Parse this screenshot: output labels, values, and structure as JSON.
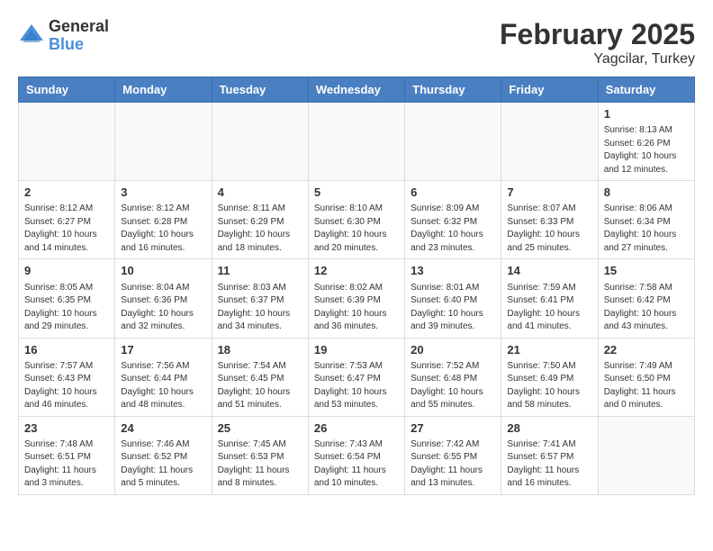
{
  "logo": {
    "general": "General",
    "blue": "Blue"
  },
  "title": {
    "month_year": "February 2025",
    "location": "Yagcilar, Turkey"
  },
  "weekdays": [
    "Sunday",
    "Monday",
    "Tuesday",
    "Wednesday",
    "Thursday",
    "Friday",
    "Saturday"
  ],
  "weeks": [
    [
      {
        "day": "",
        "info": ""
      },
      {
        "day": "",
        "info": ""
      },
      {
        "day": "",
        "info": ""
      },
      {
        "day": "",
        "info": ""
      },
      {
        "day": "",
        "info": ""
      },
      {
        "day": "",
        "info": ""
      },
      {
        "day": "1",
        "info": "Sunrise: 8:13 AM\nSunset: 6:26 PM\nDaylight: 10 hours\nand 12 minutes."
      }
    ],
    [
      {
        "day": "2",
        "info": "Sunrise: 8:12 AM\nSunset: 6:27 PM\nDaylight: 10 hours\nand 14 minutes."
      },
      {
        "day": "3",
        "info": "Sunrise: 8:12 AM\nSunset: 6:28 PM\nDaylight: 10 hours\nand 16 minutes."
      },
      {
        "day": "4",
        "info": "Sunrise: 8:11 AM\nSunset: 6:29 PM\nDaylight: 10 hours\nand 18 minutes."
      },
      {
        "day": "5",
        "info": "Sunrise: 8:10 AM\nSunset: 6:30 PM\nDaylight: 10 hours\nand 20 minutes."
      },
      {
        "day": "6",
        "info": "Sunrise: 8:09 AM\nSunset: 6:32 PM\nDaylight: 10 hours\nand 23 minutes."
      },
      {
        "day": "7",
        "info": "Sunrise: 8:07 AM\nSunset: 6:33 PM\nDaylight: 10 hours\nand 25 minutes."
      },
      {
        "day": "8",
        "info": "Sunrise: 8:06 AM\nSunset: 6:34 PM\nDaylight: 10 hours\nand 27 minutes."
      }
    ],
    [
      {
        "day": "9",
        "info": "Sunrise: 8:05 AM\nSunset: 6:35 PM\nDaylight: 10 hours\nand 29 minutes."
      },
      {
        "day": "10",
        "info": "Sunrise: 8:04 AM\nSunset: 6:36 PM\nDaylight: 10 hours\nand 32 minutes."
      },
      {
        "day": "11",
        "info": "Sunrise: 8:03 AM\nSunset: 6:37 PM\nDaylight: 10 hours\nand 34 minutes."
      },
      {
        "day": "12",
        "info": "Sunrise: 8:02 AM\nSunset: 6:39 PM\nDaylight: 10 hours\nand 36 minutes."
      },
      {
        "day": "13",
        "info": "Sunrise: 8:01 AM\nSunset: 6:40 PM\nDaylight: 10 hours\nand 39 minutes."
      },
      {
        "day": "14",
        "info": "Sunrise: 7:59 AM\nSunset: 6:41 PM\nDaylight: 10 hours\nand 41 minutes."
      },
      {
        "day": "15",
        "info": "Sunrise: 7:58 AM\nSunset: 6:42 PM\nDaylight: 10 hours\nand 43 minutes."
      }
    ],
    [
      {
        "day": "16",
        "info": "Sunrise: 7:57 AM\nSunset: 6:43 PM\nDaylight: 10 hours\nand 46 minutes."
      },
      {
        "day": "17",
        "info": "Sunrise: 7:56 AM\nSunset: 6:44 PM\nDaylight: 10 hours\nand 48 minutes."
      },
      {
        "day": "18",
        "info": "Sunrise: 7:54 AM\nSunset: 6:45 PM\nDaylight: 10 hours\nand 51 minutes."
      },
      {
        "day": "19",
        "info": "Sunrise: 7:53 AM\nSunset: 6:47 PM\nDaylight: 10 hours\nand 53 minutes."
      },
      {
        "day": "20",
        "info": "Sunrise: 7:52 AM\nSunset: 6:48 PM\nDaylight: 10 hours\nand 55 minutes."
      },
      {
        "day": "21",
        "info": "Sunrise: 7:50 AM\nSunset: 6:49 PM\nDaylight: 10 hours\nand 58 minutes."
      },
      {
        "day": "22",
        "info": "Sunrise: 7:49 AM\nSunset: 6:50 PM\nDaylight: 11 hours\nand 0 minutes."
      }
    ],
    [
      {
        "day": "23",
        "info": "Sunrise: 7:48 AM\nSunset: 6:51 PM\nDaylight: 11 hours\nand 3 minutes."
      },
      {
        "day": "24",
        "info": "Sunrise: 7:46 AM\nSunset: 6:52 PM\nDaylight: 11 hours\nand 5 minutes."
      },
      {
        "day": "25",
        "info": "Sunrise: 7:45 AM\nSunset: 6:53 PM\nDaylight: 11 hours\nand 8 minutes."
      },
      {
        "day": "26",
        "info": "Sunrise: 7:43 AM\nSunset: 6:54 PM\nDaylight: 11 hours\nand 10 minutes."
      },
      {
        "day": "27",
        "info": "Sunrise: 7:42 AM\nSunset: 6:55 PM\nDaylight: 11 hours\nand 13 minutes."
      },
      {
        "day": "28",
        "info": "Sunrise: 7:41 AM\nSunset: 6:57 PM\nDaylight: 11 hours\nand 16 minutes."
      },
      {
        "day": "",
        "info": ""
      }
    ]
  ]
}
